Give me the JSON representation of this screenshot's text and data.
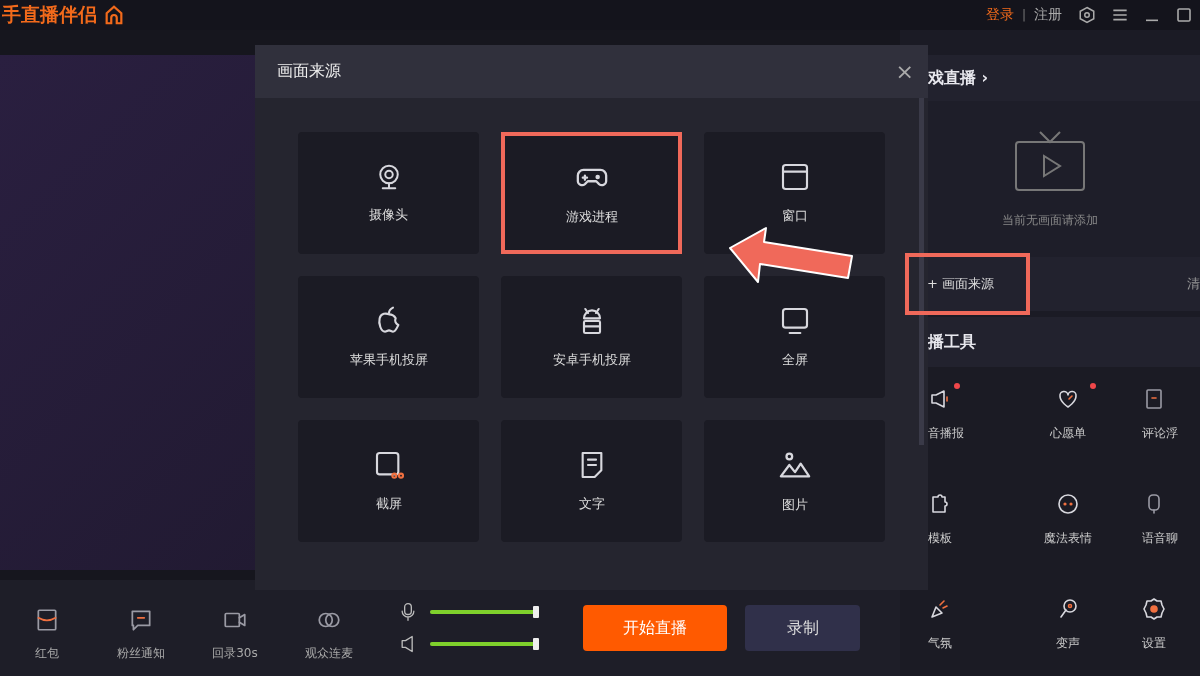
{
  "app": {
    "title": "手直播伴侣"
  },
  "top_bar": {
    "login": "登录",
    "separator": "|",
    "register": "注册"
  },
  "bottom_tools": [
    {
      "label": "红包"
    },
    {
      "label": "粉丝通知"
    },
    {
      "label": "回录30s"
    },
    {
      "label": "观众连麦"
    }
  ],
  "volume": [
    {
      "kind": "microphone",
      "level": 0.98
    },
    {
      "kind": "speaker",
      "level": 0.98
    }
  ],
  "buttons": [
    {
      "label": "开始直播",
      "kind": "primary"
    },
    {
      "label": "录制",
      "kind": "secondary"
    }
  ],
  "dialog": {
    "title": "画面来源",
    "close": "×",
    "sources": [
      {
        "label": "摄像头",
        "highlighted": false
      },
      {
        "label": "游戏进程",
        "highlighted": true
      },
      {
        "label": "窗口",
        "highlighted": false
      },
      {
        "label": "苹果手机投屏",
        "highlighted": false
      },
      {
        "label": "安卓手机投屏",
        "highlighted": false
      },
      {
        "label": "全屏",
        "highlighted": false
      },
      {
        "label": "截屏",
        "highlighted": false
      },
      {
        "label": "文字",
        "highlighted": false
      },
      {
        "label": "图片",
        "highlighted": false
      }
    ]
  },
  "right_panel": {
    "scene_title": "戏直播 ›",
    "empty_text": "当前无画面请添加",
    "add_source": {
      "label": "+ 画面来源",
      "highlighted": true
    },
    "clear": "清",
    "tools_title": "播工具",
    "tools": [
      {
        "label": "音播报",
        "dot": true
      },
      {
        "label": "心愿单",
        "dot": true
      },
      {
        "label": "评论浮",
        "dot": false
      },
      {
        "label": "模板",
        "dot": false
      },
      {
        "label": "魔法表情",
        "dot": false
      },
      {
        "label": "语音聊",
        "dot": false
      },
      {
        "label": "气氛",
        "dot": false
      },
      {
        "label": "变声",
        "dot": false
      },
      {
        "label": "设置",
        "dot": false
      }
    ]
  }
}
